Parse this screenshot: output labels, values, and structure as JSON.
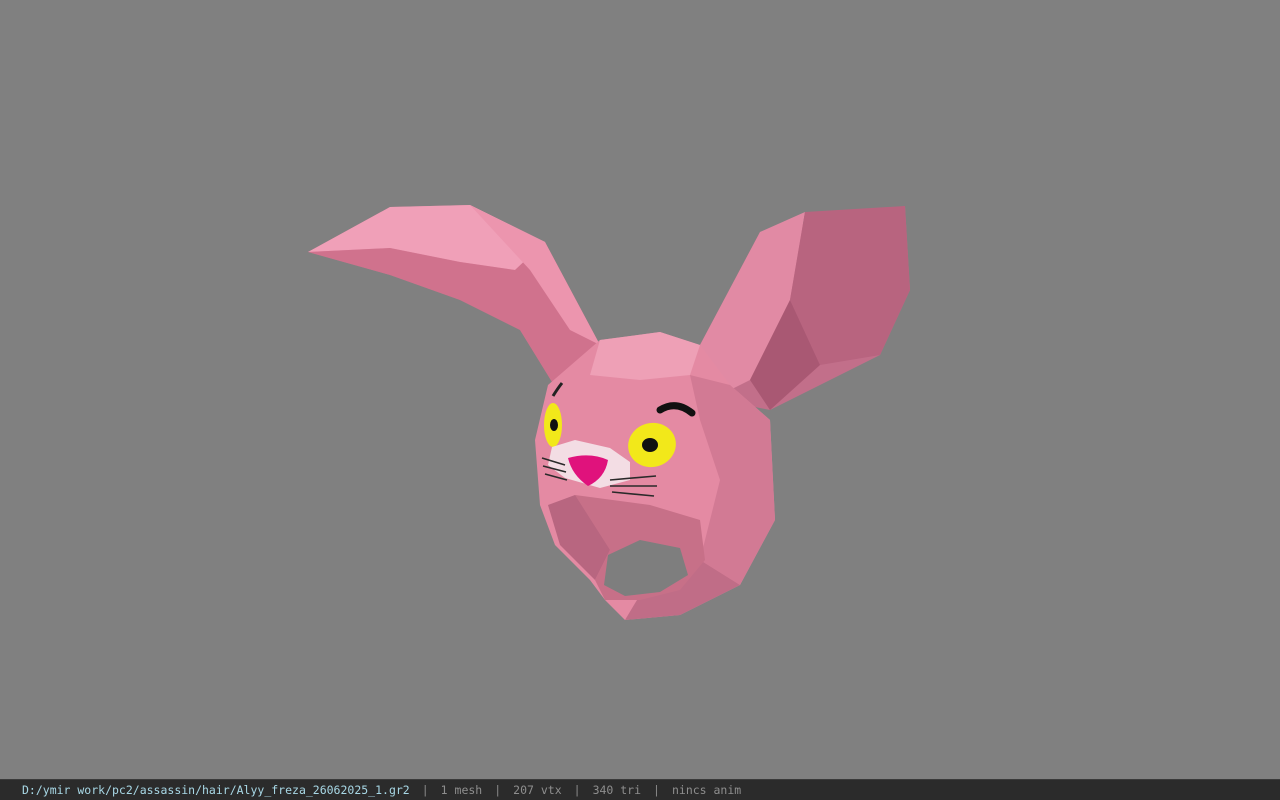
{
  "viewport": {
    "background": "#808080",
    "model_name": "bunny-hood-hair-mesh",
    "model_color": "#e8869f"
  },
  "status_bar": {
    "file_path": "D:/ymir work/pc2/assassin/hair/Alyy_freza_26062025_1.gr2",
    "separator": "|",
    "mesh_count": "1 mesh",
    "vertex_count": "207 vtx",
    "triangle_count": "340 tri",
    "anim_status": "nincs anim"
  }
}
